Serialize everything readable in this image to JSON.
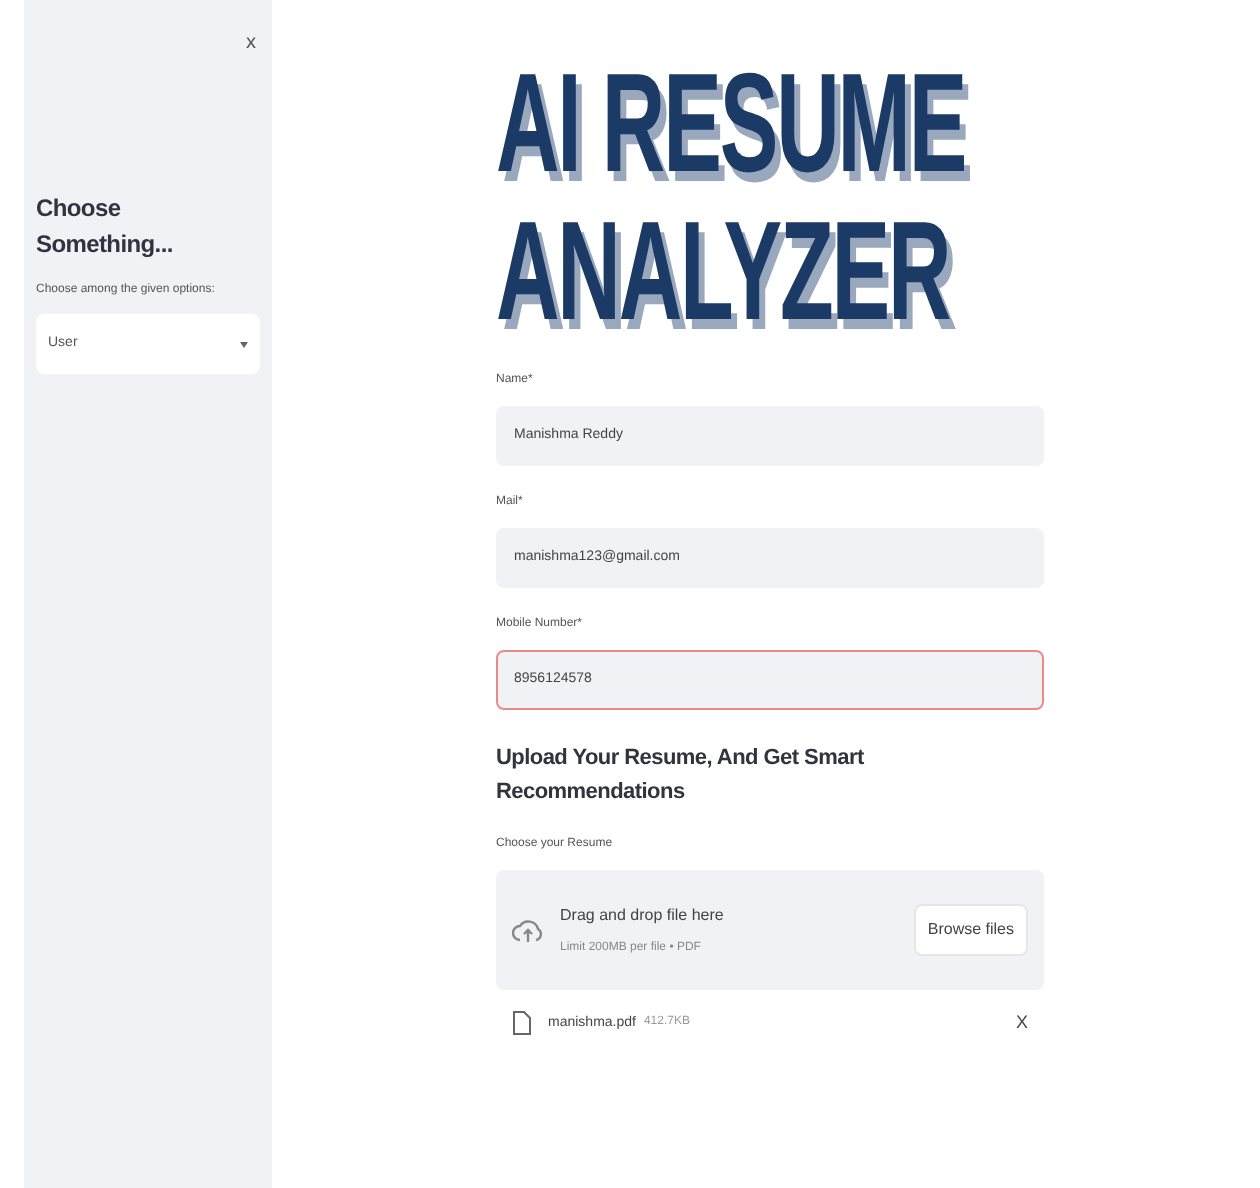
{
  "sidebar": {
    "close": "x",
    "title": "Choose Something...",
    "select_label": "Choose among the given options:",
    "select_value": "User"
  },
  "logo": {
    "lines": [
      "AI RESUME",
      "ANALYZER"
    ]
  },
  "fields": [
    {
      "label": "Name*",
      "value": "Manishma Reddy",
      "invalid": false
    },
    {
      "label": "Mail*",
      "value": "manishma123@gmail.com",
      "invalid": false
    },
    {
      "label": "Mobile Number*",
      "value": "8956124578",
      "invalid": true
    }
  ],
  "upload": {
    "heading": "Upload Your Resume, And Get Smart Recommendations",
    "label": "Choose your Resume",
    "drop_text": "Drag and drop file here",
    "limit": "Limit 200MB per file • PDF",
    "button": "Browse files",
    "file": {
      "name": "manishma.pdf",
      "size": "412.7KB",
      "remove": "X"
    }
  }
}
